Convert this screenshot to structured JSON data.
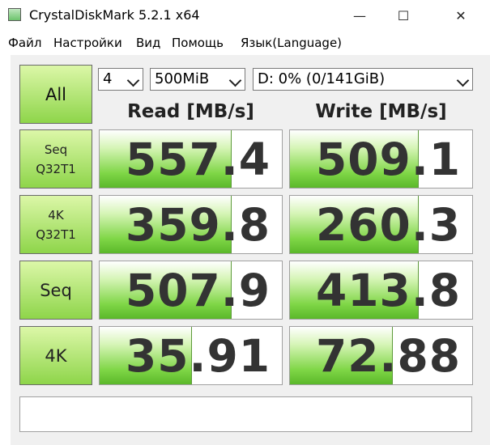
{
  "window": {
    "title": "CrystalDiskMark 5.2.1 x64",
    "minimize_glyph": "—",
    "maximize_glyph": "☐",
    "close_glyph": "✕"
  },
  "menu": [
    "Файл",
    "Настройки",
    "Вид",
    "Помощь",
    "Язык(Language)"
  ],
  "controls": {
    "all_label": "All",
    "count_value": "4",
    "size_value": "500MiB",
    "drive_value": "D: 0% (0/141GiB)"
  },
  "headers": {
    "read": "Read [MB/s]",
    "write": "Write [MB/s]"
  },
  "rows": [
    {
      "label_lines": [
        "Seq",
        "Q32T1"
      ],
      "read": "557.4",
      "write": "509.1",
      "read_fill": 0.72,
      "write_fill": 0.7
    },
    {
      "label_lines": [
        "4K",
        "Q32T1"
      ],
      "read": "359.8",
      "write": "260.3",
      "read_fill": 0.72,
      "write_fill": 0.7
    },
    {
      "label_lines": [
        "Seq"
      ],
      "read": "507.9",
      "write": "413.8",
      "read_fill": 0.72,
      "write_fill": 0.7
    },
    {
      "label_lines": [
        "4K"
      ],
      "read": "35.91",
      "write": "72.88",
      "read_fill": 0.5,
      "write_fill": 0.56
    }
  ],
  "status_text": "",
  "colors": {
    "button_green_top": "#dcf7a8",
    "button_green_bottom": "#8ed54a",
    "bar_green": "#7fd646",
    "value_text": "#333333"
  }
}
